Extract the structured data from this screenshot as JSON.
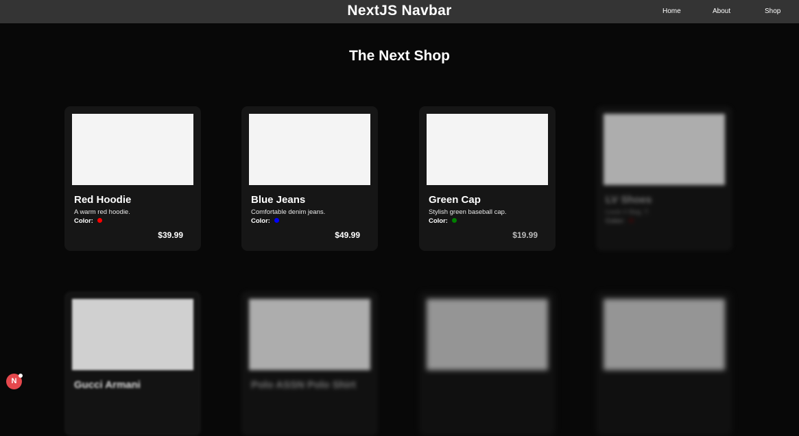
{
  "navbar": {
    "brand": "NextJS Navbar",
    "links": [
      {
        "label": "Home"
      },
      {
        "label": "About"
      },
      {
        "label": "Shop"
      }
    ]
  },
  "page": {
    "title": "The Next Shop"
  },
  "products": [
    {
      "name": "Red Hoodie",
      "description": "A warm red hoodie.",
      "color_label": "Color:",
      "color": "#ff0000",
      "price": "$39.99"
    },
    {
      "name": "Blue Jeans",
      "description": "Comfortable denim jeans.",
      "color_label": "Color:",
      "color": "#0000ff",
      "price": "$49.99"
    },
    {
      "name": "Green Cap",
      "description": "Stylish green baseball cap.",
      "color_label": "Color:",
      "color": "#008000",
      "price": "$19.99"
    },
    {
      "name": "LV Shoes",
      "description": "Louis V Bag, T.",
      "color_label": "Color:",
      "color": "#7a0000",
      "price": ""
    },
    {
      "name": "Gucci Armani",
      "description": "",
      "color_label": "",
      "color": "",
      "price": ""
    },
    {
      "name": "Polo ASSN Polo Shirt",
      "description": "",
      "color_label": "",
      "color": "",
      "price": ""
    },
    {
      "name": "",
      "description": "",
      "color_label": "",
      "color": "",
      "price": ""
    },
    {
      "name": "",
      "description": "",
      "color_label": "",
      "color": "",
      "price": ""
    }
  ],
  "dev_badge": {
    "letter": "N",
    "color": "#e5484d"
  }
}
